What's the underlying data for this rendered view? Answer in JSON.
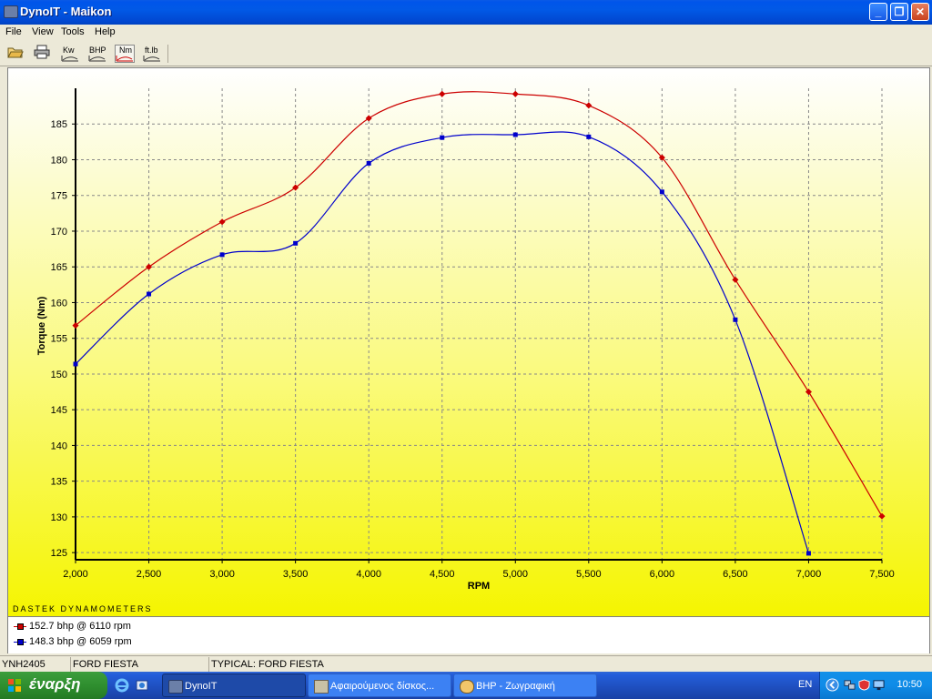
{
  "window": {
    "title": "DynoIT - Maikon"
  },
  "menu": [
    "File",
    "View",
    "Tools",
    "Help"
  ],
  "toolbar": {
    "kw": "Kw",
    "bhp": "BHP",
    "nm": "Nm",
    "ftlb": "ft.lb"
  },
  "chart_data": {
    "type": "line",
    "xlabel": "RPM",
    "ylabel": "Torque (Nm)",
    "xlim": [
      2000,
      7500
    ],
    "ylim": [
      124,
      190
    ],
    "x_ticks": [
      "2,000",
      "2,500",
      "3,000",
      "3,500",
      "4,000",
      "4,500",
      "5,000",
      "5,500",
      "6,000",
      "6,500",
      "7,000",
      "7,500"
    ],
    "y_ticks": [
      "125",
      "130",
      "135",
      "140",
      "145",
      "150",
      "155",
      "160",
      "165",
      "170",
      "175",
      "180",
      "185"
    ],
    "x": [
      2000,
      2500,
      3000,
      3500,
      4000,
      4500,
      5000,
      5500,
      6000,
      6500,
      7000,
      7500
    ],
    "grid": true,
    "series": [
      {
        "name": "152.7 bhp @ 6110 rpm",
        "color": "#cc0000",
        "values": [
          156.8,
          165.0,
          171.3,
          176.1,
          185.8,
          189.2,
          189.2,
          187.6,
          180.3,
          163.2,
          147.5,
          130.1
        ]
      },
      {
        "name": "148.3 bhp @ 6059 rpm",
        "color": "#0000cc",
        "values": [
          151.4,
          161.2,
          166.7,
          168.3,
          179.5,
          183.1,
          183.5,
          183.2,
          175.5,
          157.6,
          124.9,
          null
        ]
      }
    ],
    "watermark": "DASTEK DYNAMOMETERS"
  },
  "status": {
    "vehicle_id": "YNH2405",
    "model": "FORD FIESTA",
    "typical": "TYPICAL: FORD FIESTA"
  },
  "taskbar": {
    "start": "έναρξη",
    "tasks": [
      "DynoIT",
      "Αφαιρούμενος δίσκος...",
      "BHP - Ζωγραφική"
    ],
    "lang": "EN",
    "clock": "10:50"
  }
}
